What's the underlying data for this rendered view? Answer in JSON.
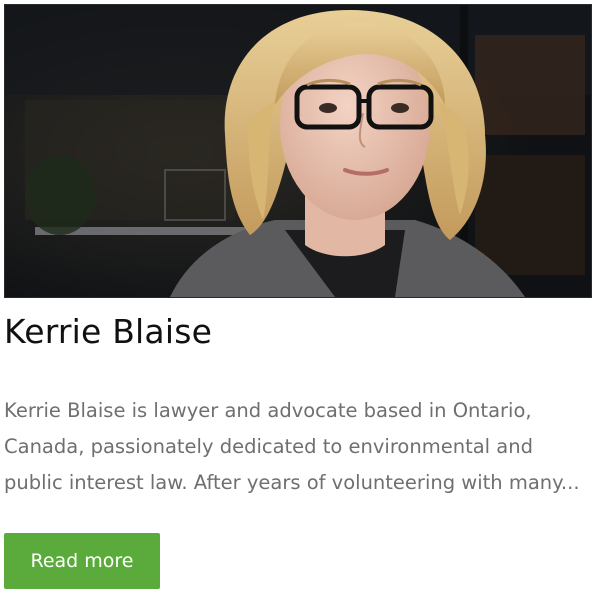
{
  "card": {
    "photo_alt": "Kerrie Blaise",
    "name": "Kerrie Blaise",
    "excerpt_lines": [
      "Kerrie Blaise is lawyer and advocate based in Ontario,",
      "Canada, passionately dedicated to environmental and",
      "public interest law. After years of volunteering with many..."
    ],
    "read_more_label": "Read more"
  },
  "colors": {
    "button_bg": "#5aab3b",
    "button_text": "#ffffff",
    "name_text": "#111111",
    "excerpt_text": "#6f6f6f"
  }
}
